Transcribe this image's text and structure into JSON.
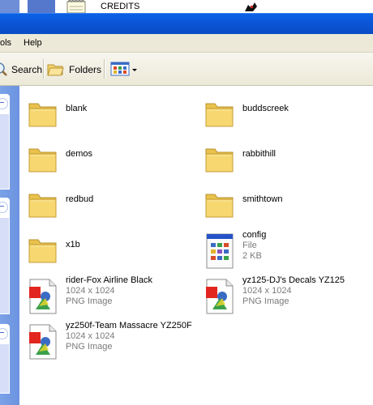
{
  "desktop": {
    "credits_label": "CREDITS"
  },
  "menu": {
    "tools_label": "ols",
    "help_label": "Help"
  },
  "toolbar": {
    "search_label": "Search",
    "folders_label": "Folders"
  },
  "folders": [
    {
      "name": "blank"
    },
    {
      "name": "buddscreek"
    },
    {
      "name": "demos"
    },
    {
      "name": "rabbithill"
    },
    {
      "name": "redbud"
    },
    {
      "name": "smithtown"
    },
    {
      "name": "x1b"
    }
  ],
  "files": [
    {
      "name": "config",
      "line1": "File",
      "line2": "2 KB"
    },
    {
      "name": "rider-Fox Airline Black",
      "line1": "1024 x 1024",
      "line2": "PNG Image"
    },
    {
      "name": "yz125-DJ's Decals YZ125",
      "line1": "1024 x 1024",
      "line2": "PNG Image"
    },
    {
      "name": "yz250f-Team Massacre YZ250F",
      "line1": "1024 x 1024",
      "line2": "PNG Image"
    }
  ],
  "colors": {
    "titlebar": "#0a56d8",
    "taskpane": "#7ba2e7",
    "folder": "#f5d66b"
  }
}
